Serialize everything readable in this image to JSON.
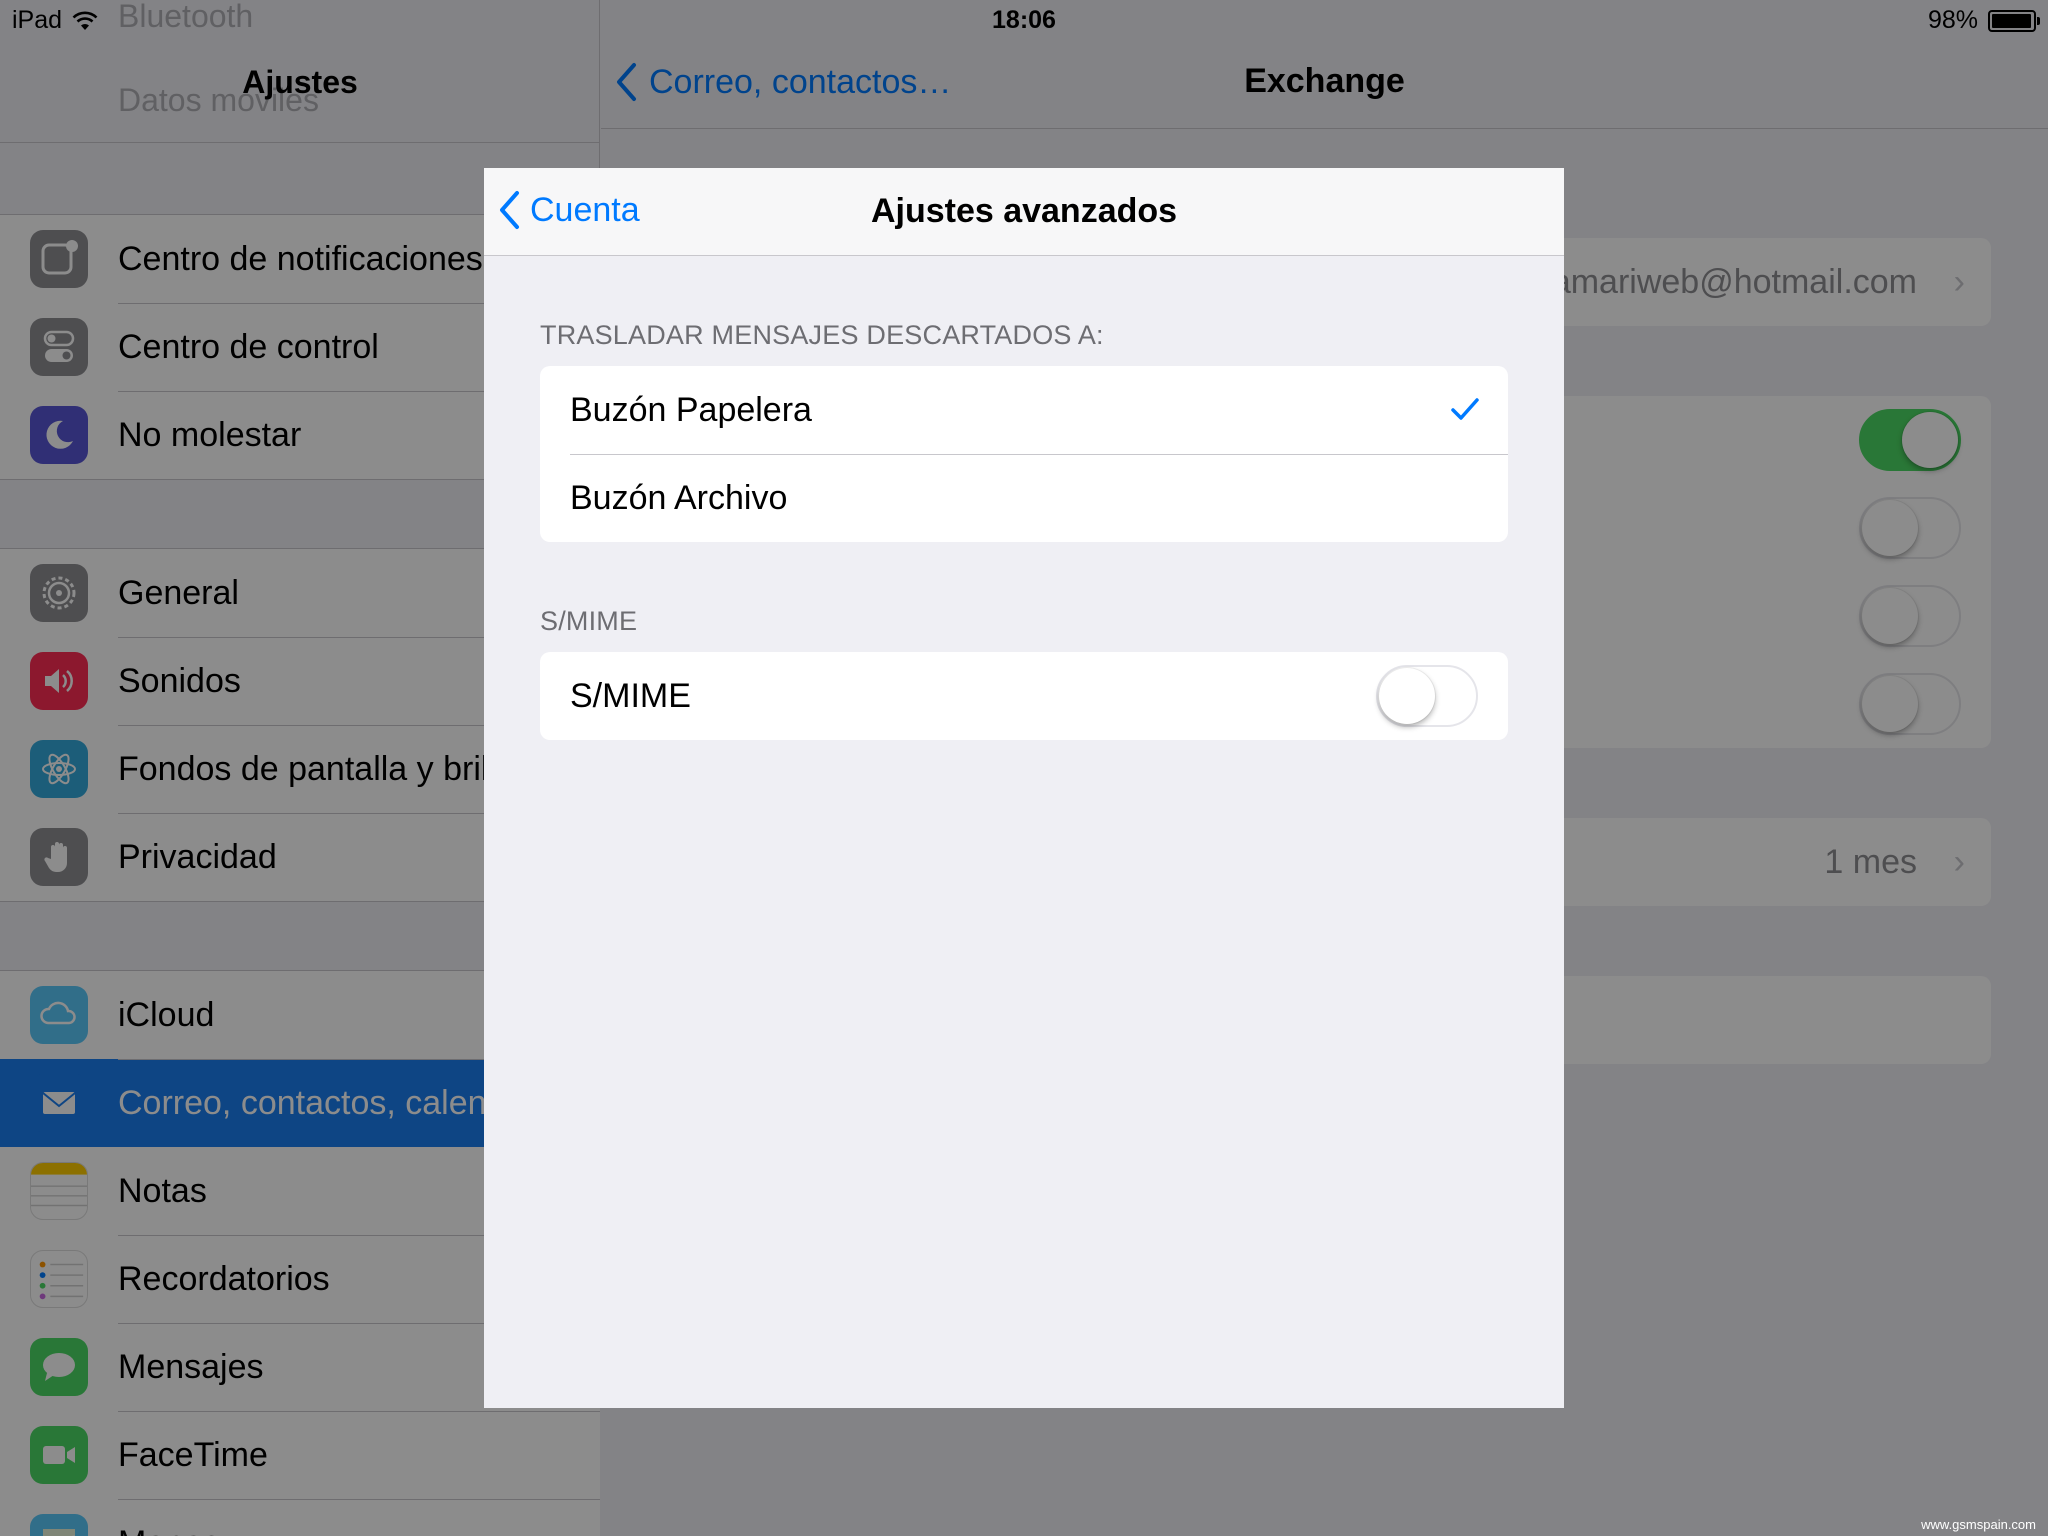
{
  "status_bar": {
    "carrier": "iPad",
    "time": "18:06",
    "battery": "98%",
    "battery_level": 0.98
  },
  "sidebar": {
    "title": "Ajustes",
    "ghost_items": [
      "Bluetooth",
      "Datos móviles"
    ],
    "groups": [
      [
        {
          "label": "Centro de notificaciones",
          "icon": "notifications-icon",
          "color": "#8e8e93"
        },
        {
          "label": "Centro de control",
          "icon": "control-center-icon",
          "color": "#8e8e93"
        },
        {
          "label": "No molestar",
          "icon": "moon-icon",
          "color": "#5856d6"
        }
      ],
      [
        {
          "label": "General",
          "icon": "gear-icon",
          "color": "#8e8e93"
        },
        {
          "label": "Sonidos",
          "icon": "speaker-icon",
          "color": "#ff2d55"
        },
        {
          "label": "Fondos de pantalla y brillo",
          "icon": "wallpaper-icon",
          "color": "#34aadc"
        },
        {
          "label": "Privacidad",
          "icon": "hand-icon",
          "color": "#8e8e93"
        }
      ],
      [
        {
          "label": "iCloud",
          "icon": "cloud-icon",
          "color": "#5ac8fa"
        },
        {
          "label": "Correo, contactos, calendarios",
          "icon": "mail-icon",
          "color": "#1a7ef0",
          "selected": true
        },
        {
          "label": "Notas",
          "icon": "notes-icon",
          "color": "#ffcc00"
        },
        {
          "label": "Recordatorios",
          "icon": "reminders-icon",
          "color": "#ffffff"
        },
        {
          "label": "Mensajes",
          "icon": "messages-icon",
          "color": "#4cd964"
        },
        {
          "label": "FaceTime",
          "icon": "facetime-icon",
          "color": "#4cd964"
        },
        {
          "label": "Mapas",
          "icon": "maps-icon",
          "color": "#5ac8fa"
        }
      ]
    ]
  },
  "detail": {
    "back_label": "Correo, contactos…",
    "title": "Exchange",
    "account_value": "amariweb@hotmail.com",
    "toggles": [
      true,
      false,
      false,
      false
    ],
    "sync_value": "1 mes"
  },
  "modal": {
    "back_label": "Cuenta",
    "title": "Ajustes avanzados",
    "section1_header": "TRASLADAR MENSAJES DESCARTADOS A:",
    "options": [
      {
        "label": "Buzón Papelera",
        "checked": true
      },
      {
        "label": "Buzón Archivo",
        "checked": false
      }
    ],
    "section2_header": "S/MIME",
    "smime_label": "S/MIME",
    "smime_on": false
  },
  "colors": {
    "accent": "#007aff",
    "selection": "#1a7ef0",
    "switch_on": "#4cd964"
  },
  "watermark": "www.gsmspain.com"
}
